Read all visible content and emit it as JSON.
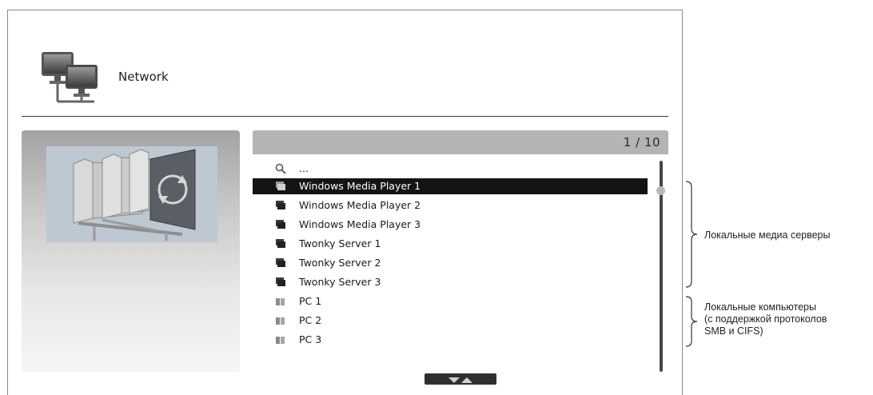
{
  "header": {
    "title": "Network"
  },
  "list": {
    "page_indicator": "1 / 10",
    "items": [
      {
        "label": "...",
        "icon": "search-icon",
        "selected": false
      },
      {
        "label": "Windows Media Player 1",
        "icon": "media-server-icon",
        "selected": true
      },
      {
        "label": "Windows Media Player 2",
        "icon": "media-server-icon",
        "selected": false
      },
      {
        "label": "Windows Media Player 3",
        "icon": "media-server-icon",
        "selected": false
      },
      {
        "label": "Twonky Server 1",
        "icon": "media-server-icon",
        "selected": false
      },
      {
        "label": "Twonky Server 2",
        "icon": "media-server-icon",
        "selected": false
      },
      {
        "label": "Twonky Server 3",
        "icon": "media-server-icon",
        "selected": false
      },
      {
        "label": "PC 1",
        "icon": "computer-share-icon",
        "selected": false
      },
      {
        "label": "PC 2",
        "icon": "computer-share-icon",
        "selected": false
      },
      {
        "label": "PC 3",
        "icon": "computer-share-icon",
        "selected": false
      }
    ]
  },
  "annotations": {
    "media_servers": "Локальные медиа серверы",
    "computers_line1": "Локальные компьютеры",
    "computers_line2": "(с поддержкой протоколов",
    "computers_line3": "SMB и CIFS)"
  },
  "colors": {
    "selected_row": "#141414",
    "list_header": "#b4b4b4",
    "preview_image_bg": "#bdc8d3"
  }
}
